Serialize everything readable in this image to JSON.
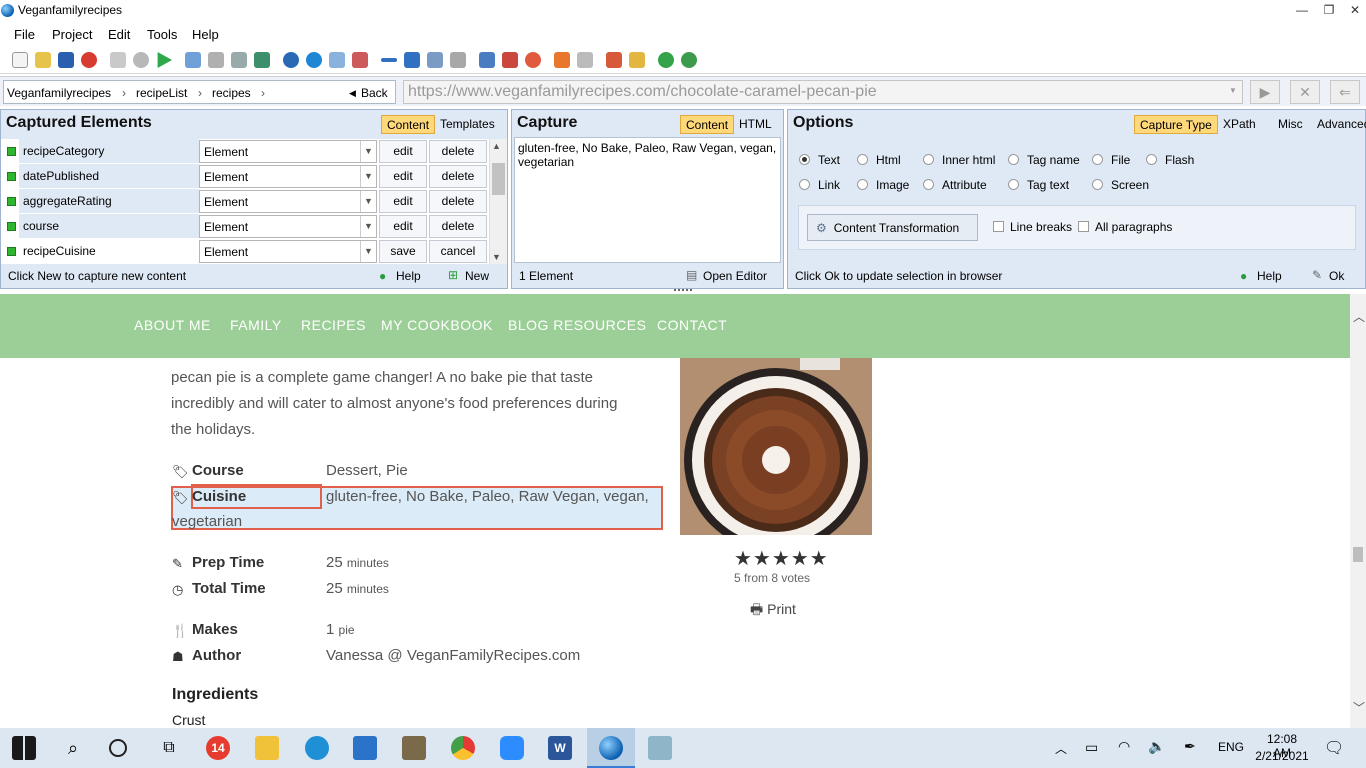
{
  "window": {
    "title": "Veganfamilyrecipes"
  },
  "menu": [
    "File",
    "Project",
    "Edit",
    "Tools",
    "Help"
  ],
  "breadcrumb": {
    "items": [
      "Veganfamilyrecipes",
      "recipeList",
      "recipes"
    ],
    "back": "Back"
  },
  "url": "https://www.veganfamilyrecipes.com/chocolate-caramel-pecan-pie",
  "captured": {
    "title": "Captured Elements",
    "tabs": [
      "Content",
      "Templates"
    ],
    "rows": [
      {
        "name": "recipeCategory",
        "type": "Element",
        "b1": "edit",
        "b2": "delete"
      },
      {
        "name": "datePublished",
        "type": "Element",
        "b1": "edit",
        "b2": "delete"
      },
      {
        "name": "aggregateRating",
        "type": "Element",
        "b1": "edit",
        "b2": "delete"
      },
      {
        "name": "course",
        "type": "Element",
        "b1": "edit",
        "b2": "delete"
      },
      {
        "name": "recipeCuisine",
        "type": "Element",
        "b1": "save",
        "b2": "cancel"
      }
    ],
    "footer_hint": "Click New to capture new content",
    "help": "Help",
    "new": "New"
  },
  "capture": {
    "title": "Capture",
    "tabs": [
      "Content",
      "HTML"
    ],
    "text": "gluten-free, No Bake, Paleo, Raw Vegan, vegan, vegetarian",
    "count": "1 Element",
    "open_editor": "Open Editor"
  },
  "options": {
    "title": "Options",
    "tabs": [
      "Capture Type",
      "XPath",
      "Misc",
      "Advanced"
    ],
    "radios_row1": [
      "Text",
      "Html",
      "Inner html",
      "Tag name",
      "File",
      "Flash"
    ],
    "radios_row2": [
      "Link",
      "Image",
      "Attribute",
      "Tag text",
      "Screen"
    ],
    "transform_btn": "Content Transformation",
    "line_breaks": "Line breaks",
    "all_paragraphs": "All paragraphs",
    "footer_hint": "Click Ok to update selection in browser",
    "help": "Help",
    "ok": "Ok"
  },
  "site_nav": [
    "ABOUT ME",
    "FAMILY",
    "RECIPES",
    "MY COOKBOOK",
    "BLOG RESOURCES",
    "CONTACT"
  ],
  "recipe": {
    "intro_line1": "pecan pie is a complete game changer! A no bake pie that taste",
    "intro_line2": "incredibly and will cater to almost anyone's food preferences during",
    "intro_line3": "the holidays.",
    "course_label": "Course",
    "course_value": "Dessert, Pie",
    "cuisine_label": "Cuisine",
    "cuisine_value1": "gluten-free, No Bake, Paleo, Raw Vegan, vegan,",
    "cuisine_value2": "vegetarian",
    "prep_label": "Prep Time",
    "prep_num": "25",
    "prep_unit": "minutes",
    "total_label": "Total Time",
    "total_num": "25",
    "total_unit": "minutes",
    "makes_label": "Makes",
    "makes_num": "1",
    "makes_unit": "pie",
    "author_label": "Author",
    "author_value": "Vanessa @ VeganFamilyRecipes.com",
    "ingredients_heading": "Ingredients",
    "crust": "Crust",
    "stars": "★★★★★",
    "rating_text": "5 from 8 votes",
    "print": "Print"
  },
  "taskbar": {
    "lang": "ENG",
    "time": "12:08 AM",
    "date": "2/21/2021",
    "badge": "14"
  }
}
